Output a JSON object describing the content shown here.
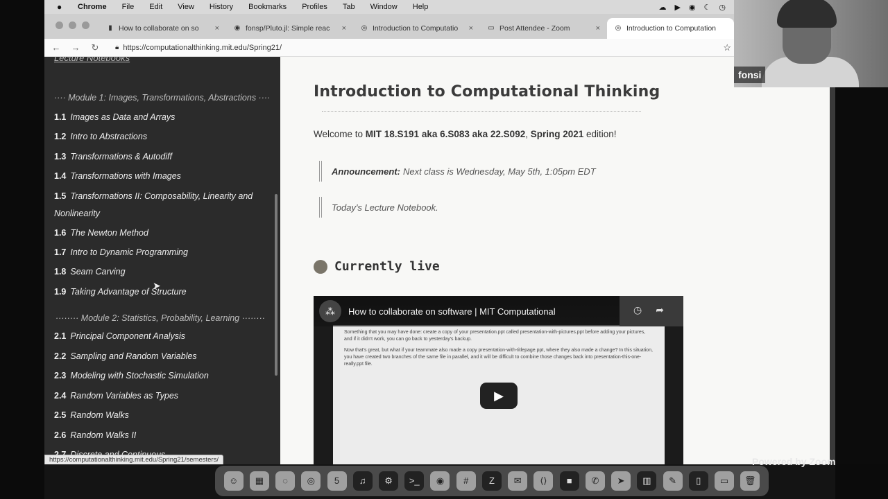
{
  "menubar": {
    "apple": "",
    "items": [
      "Chrome",
      "File",
      "Edit",
      "View",
      "History",
      "Bookmarks",
      "Profiles",
      "Tab",
      "Window",
      "Help"
    ]
  },
  "tabs": [
    {
      "label": "How to collaborate on so",
      "icon": "youtube-icon"
    },
    {
      "label": "fonsp/Pluto.jl: Simple reac",
      "icon": "github-icon"
    },
    {
      "label": "Introduction to Computatio",
      "icon": "globe-icon"
    },
    {
      "label": "Post Attendee - Zoom",
      "icon": "zoom-icon"
    },
    {
      "label": "Introduction to Computation",
      "icon": "globe-icon"
    }
  ],
  "address": {
    "url": "https://computationalthinking.mit.edu/Spring21/"
  },
  "sidebar": {
    "top_link": "Lecture Notebooks",
    "module1": "Module 1: Images, Transformations, Abstractions",
    "module1_items": [
      {
        "num": "1.1",
        "title": "Images as Data and Arrays"
      },
      {
        "num": "1.2",
        "title": "Intro to Abstractions"
      },
      {
        "num": "1.3",
        "title": "Transformations & Autodiff"
      },
      {
        "num": "1.4",
        "title": "Transformations with Images"
      },
      {
        "num": "1.5",
        "title": "Transformations II: Composability, Linearity and Nonlinearity"
      },
      {
        "num": "1.6",
        "title": "The Newton Method"
      },
      {
        "num": "1.7",
        "title": "Intro to Dynamic Programming"
      },
      {
        "num": "1.8",
        "title": "Seam Carving"
      },
      {
        "num": "1.9",
        "title": "Taking Advantage of Structure"
      }
    ],
    "module2": "Module 2: Statistics, Probability, Learning",
    "module2_items": [
      {
        "num": "2.1",
        "title": "Principal Component Analysis"
      },
      {
        "num": "2.2",
        "title": "Sampling and Random Variables"
      },
      {
        "num": "2.3",
        "title": "Modeling with Stochastic Simulation"
      },
      {
        "num": "2.4",
        "title": "Random Variables as Types"
      },
      {
        "num": "2.5",
        "title": "Random Walks"
      },
      {
        "num": "2.6",
        "title": "Random Walks II"
      },
      {
        "num": "2.7",
        "title": "Discrete and Continuous"
      }
    ]
  },
  "main": {
    "title": "Introduction to Computational Thinking",
    "welcome_pre": "Welcome to ",
    "welcome_course": "MIT 18.S191 aka 6.S083 aka 22.S092",
    "welcome_sep": ", ",
    "welcome_edition": "Spring 2021",
    "welcome_post": " edition!",
    "announcement_label": "Announcement:",
    "announcement_text": "Next class is Wednesday, May 5th, 1:05pm EDT",
    "lecture_link": "Today's Lecture Notebook.",
    "live_heading": "Currently live"
  },
  "video": {
    "title": "How to collaborate on software | MIT Computational",
    "para1": "Something that you may have done: create a copy of your presentation.ppt called presentation-with-pictures.ppt before adding your pictures, and if it didn't work, you can go back to yesterday's backup.",
    "para2": "Now that's great, but what if your teammate also made a copy presentation-with-titlepage.ppt, where they also made a change? In this situation, you have created two branches of the same file in parallel, and it will be difficult to combine those changes back into presentation-this-one-really.ppt file.",
    "play": "▶"
  },
  "camera": {
    "name": "fonsi"
  },
  "status_link": "https://computationalthinking.mit.edu/Spring21/semesters/",
  "powered": "Powered by Zoom",
  "dock": [
    "finder-icon",
    "launchpad-icon",
    "safari-icon",
    "chrome-icon",
    "calendar-icon",
    "music-icon",
    "settings-icon",
    "terminal-icon",
    "github-desktop-icon",
    "slack-icon",
    "zotero-icon",
    "mail-icon",
    "vscode-icon",
    "zoom-icon",
    "whatsapp-icon",
    "telegram-icon",
    "activity-icon",
    "notes-icon",
    "preview-icon",
    "screenshot-icon",
    "trash-icon"
  ],
  "dock_calendar": "5"
}
